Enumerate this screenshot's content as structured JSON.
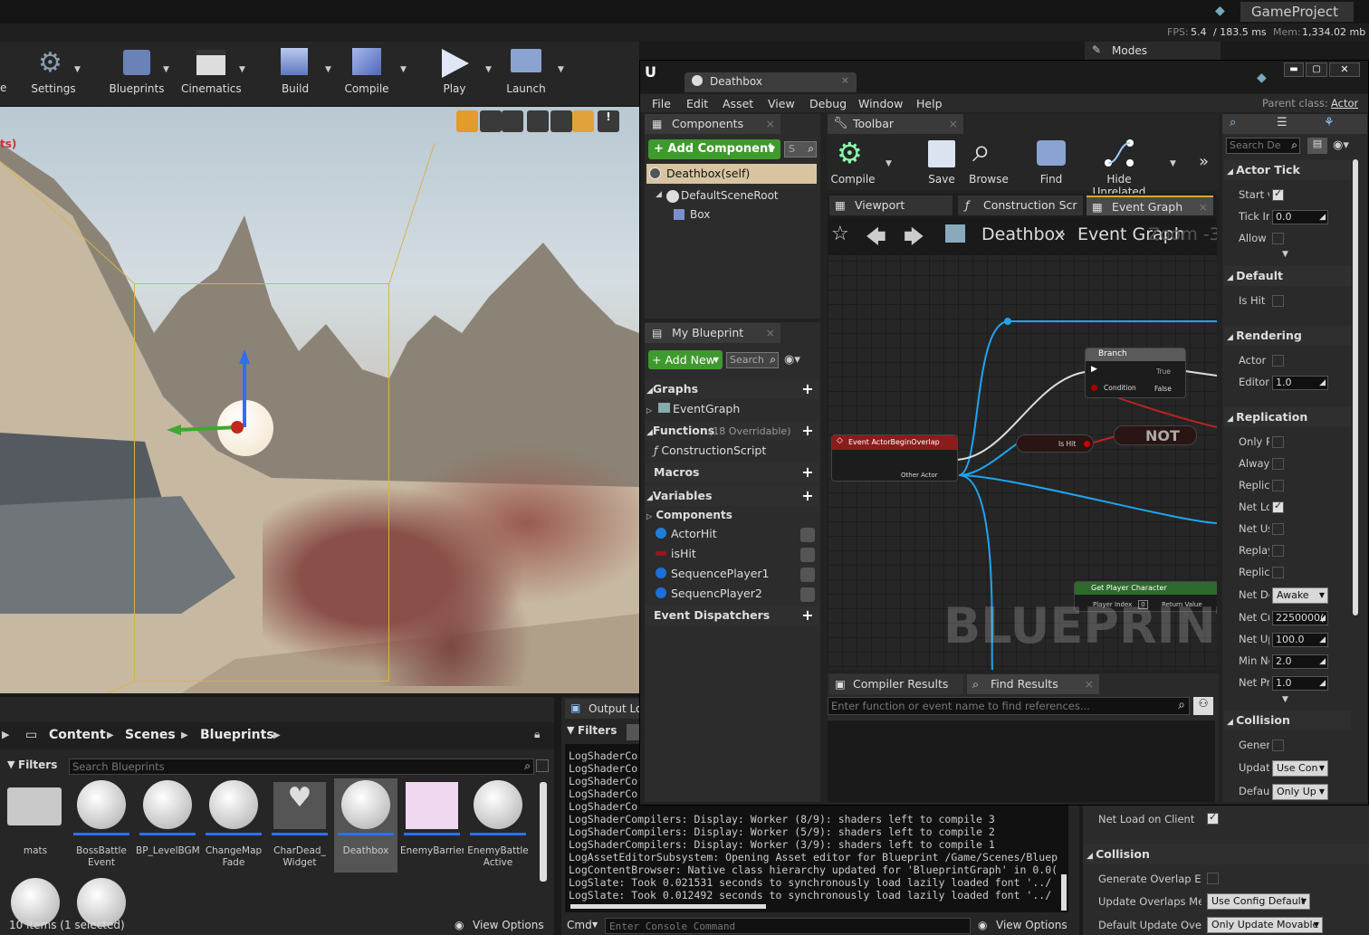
{
  "top": {
    "project": "GameProject",
    "fps_label": "FPS:",
    "fps": "5.4",
    "ms": "/ 183.5 ms",
    "mem_label": "Mem:",
    "mem": "1,334.02 mb",
    "modes": "Modes"
  },
  "toolbar": {
    "cut": "e",
    "settings": "Settings",
    "blueprints": "Blueprints",
    "cinematics": "Cinematics",
    "build": "Build",
    "compile": "Compile",
    "play": "Play",
    "launch": "Launch"
  },
  "viewport": {
    "overlay": "ts)"
  },
  "content": {
    "breadcrumb": [
      "Content",
      "Scenes",
      "Blueprints"
    ],
    "filters": "Filters",
    "search_placeholder": "Search Blueprints",
    "items": [
      {
        "l1": "mats",
        "l2": ""
      },
      {
        "l1": "BossBattle",
        "l2": "Event"
      },
      {
        "l1": "BP_LevelBGM",
        "l2": ""
      },
      {
        "l1": "ChangeMap",
        "l2": "Fade"
      },
      {
        "l1": "CharDead_",
        "l2": "Widget"
      },
      {
        "l1": "Deathbox",
        "l2": ""
      },
      {
        "l1": "EnemyBarrier",
        "l2": ""
      },
      {
        "l1": "EnemyBattle",
        "l2": "Active"
      }
    ],
    "status": "10 items (1 selected)",
    "view_options": "View Options"
  },
  "output": {
    "tab": "Output Lo",
    "filters": "Filters",
    "lines_cut": [
      "LogShaderCo",
      "LogShaderCo",
      "LogShaderCo",
      "LogShaderCo",
      "LogShaderCo"
    ],
    "lines": [
      "LogShaderCompilers: Display: Worker (8/9): shaders left to compile 3",
      "LogShaderCompilers: Display: Worker (5/9): shaders left to compile 2",
      "LogShaderCompilers: Display: Worker (3/9): shaders left to compile 1",
      "LogAssetEditorSubsystem: Opening Asset editor for Blueprint /Game/Scenes/Bluep",
      "LogContentBrowser: Native class hierarchy updated for 'BlueprintGraph' in 0.0(",
      "LogSlate: Took 0.021531 seconds to synchronously load lazily loaded font '../",
      "LogSlate: Took 0.012492 seconds to synchronously load lazily loaded font '../"
    ],
    "cmd": "Cmd",
    "console_placeholder": "Enter Console Command",
    "view_options": "View Options"
  },
  "bp": {
    "tab": "Deathbox",
    "menu": [
      "File",
      "Edit",
      "Asset",
      "View",
      "Debug",
      "Window",
      "Help"
    ],
    "parent_label": "Parent class:",
    "parent_value": "Actor",
    "components": {
      "title": "Components",
      "add": "+ Add Component",
      "search": "S",
      "self": "Deathbox(self)",
      "root": "DefaultSceneRoot",
      "box": "Box"
    },
    "toolbar": {
      "title": "Toolbar",
      "compile": "Compile",
      "save": "Save",
      "browse": "Browse",
      "find": "Find",
      "hide": "Hide Unrelated"
    },
    "tabs": [
      "Viewport",
      "Construction Scr",
      "Event Graph"
    ],
    "graph": {
      "crumb1": "Deathbox",
      "crumb2": "Event Graph",
      "zoom": "Zoom -3",
      "watermark": "BLUEPRINT",
      "nodes": {
        "branch": "Branch",
        "true": "True",
        "false": "False",
        "condition": "Condition",
        "overlap": "Event ActorBeginOverlap",
        "other": "Other Actor",
        "ishit": "Is Hit",
        "not": "NOT",
        "getplayer": "Get Player Character",
        "playerindex": "Player Index",
        "playerindex_val": "0",
        "return": "Return Value"
      }
    },
    "myblueprint": {
      "title": "My Blueprint",
      "add": "+ Add New",
      "search": "Search",
      "graphs": "Graphs",
      "eventgraph": "EventGraph",
      "functions": "Functions",
      "functions_count": "(18 Overridable)",
      "construction": "ConstructionScript",
      "macros": "Macros",
      "variables": "Variables",
      "components": "Components",
      "vars": [
        "ActorHit",
        "isHit",
        "SequencePlayer1",
        "SequencPlayer2"
      ],
      "dispatchers": "Event Dispatchers"
    },
    "results": {
      "compiler": "Compiler Results",
      "find": "Find Results",
      "placeholder": "Enter function or event name to find references..."
    },
    "details": {
      "search": "Search De",
      "sections": {
        "actortick": "Actor Tick",
        "default": "Default",
        "rendering": "Rendering",
        "replication": "Replication",
        "collision": "Collision"
      },
      "tick": [
        {
          "l": "Start v",
          "type": "check",
          "on": true
        },
        {
          "l": "Tick Ir",
          "type": "num",
          "v": "0.0"
        },
        {
          "l": "Allow",
          "type": "check",
          "on": false
        }
      ],
      "def": [
        {
          "l": "Is Hit",
          "type": "check",
          "on": false
        }
      ],
      "rend": [
        {
          "l": "Actor I",
          "type": "check",
          "on": false
        },
        {
          "l": "Editor",
          "type": "num",
          "v": "1.0"
        }
      ],
      "rep": [
        {
          "l": "Only R",
          "type": "check",
          "on": false
        },
        {
          "l": "Alway:",
          "type": "check",
          "on": false
        },
        {
          "l": "Replic",
          "type": "check",
          "on": false
        },
        {
          "l": "Net Lo",
          "type": "check",
          "on": true
        },
        {
          "l": "Net Us",
          "type": "check",
          "on": false
        },
        {
          "l": "Replay",
          "type": "check",
          "on": false
        },
        {
          "l": "Replic",
          "type": "check",
          "on": false
        },
        {
          "l": "Net Dc",
          "type": "drop",
          "v": "Awake"
        },
        {
          "l": "Net Cu",
          "type": "num",
          "v": "2250000("
        },
        {
          "l": "Net Up",
          "type": "num",
          "v": "100.0"
        },
        {
          "l": "Min Ne",
          "type": "num",
          "v": "2.0"
        },
        {
          "l": "Net Pr",
          "type": "num",
          "v": "1.0"
        }
      ],
      "col": [
        {
          "l": "Genera",
          "type": "check",
          "on": false
        },
        {
          "l": "Update",
          "type": "drop",
          "v": "Use Con"
        },
        {
          "l": "Defaul",
          "type": "drop",
          "v": "Only Up"
        }
      ]
    }
  },
  "underpanel": {
    "netload": "Net Load on Client",
    "collision": "Collision",
    "genoverlap": "Generate Overlap Even",
    "updateoverlaps": "Update Overlaps Metho",
    "updateoverlaps_val": "Use Config Default",
    "defupdate": "Default Update Overlap",
    "defupdate_val": "Only Update Movable"
  }
}
